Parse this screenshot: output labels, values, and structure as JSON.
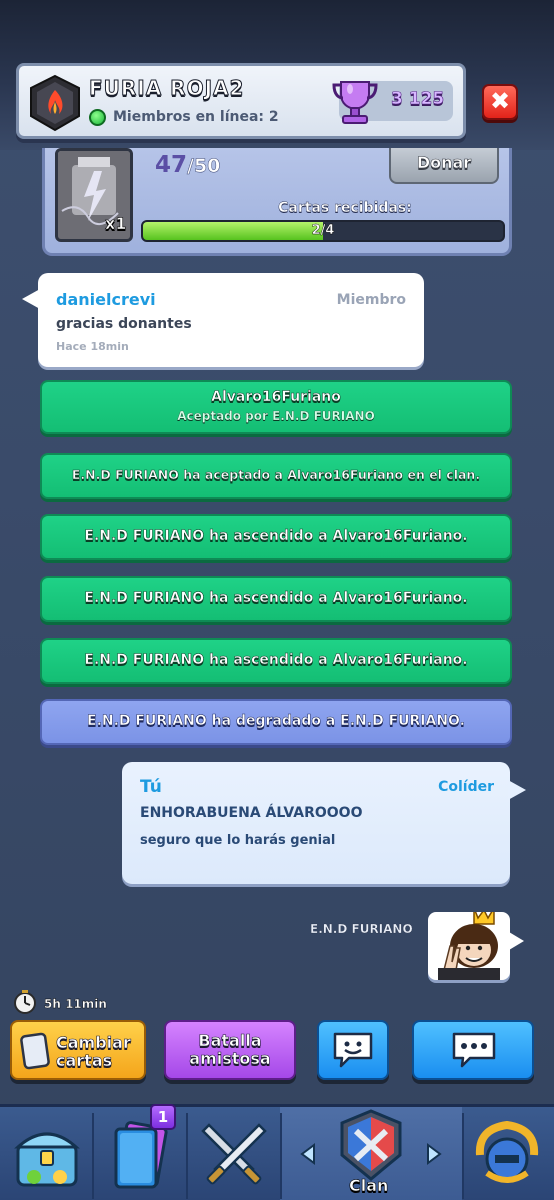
{
  "header": {
    "clan_name": "FURIA ROJA2",
    "online_label": "Miembros en línea: 2",
    "trophies": "3 125"
  },
  "donation": {
    "card_count": "x1",
    "requested_current": "47",
    "requested_total": "/50",
    "donate_label": "Donar",
    "cards_received_label": "Cartas recibidas:",
    "progress_text": "2/4",
    "progress_fraction": 0.5
  },
  "messages": [
    {
      "name": "danielcrevi",
      "role": "Miembro",
      "text": "gracias donantes",
      "time": "Hace 18min"
    }
  ],
  "events": [
    {
      "line1": "Alvaro16Furiano",
      "line2": "Aceptado por E.N.D FURIANO",
      "color": "green"
    },
    {
      "line1": "E.N.D FURIANO ha aceptado a Alvaro16Furiano en el clan.",
      "color": "green"
    },
    {
      "line1": "E.N.D FURIANO ha ascendido a Alvaro16Furiano.",
      "color": "green"
    },
    {
      "line1": "E.N.D FURIANO ha ascendido a Alvaro16Furiano.",
      "color": "green"
    },
    {
      "line1": "E.N.D FURIANO ha ascendido a Alvaro16Furiano.",
      "color": "green"
    },
    {
      "line1": "E.N.D FURIANO ha degradado a E.N.D FURIANO.",
      "color": "blue"
    }
  ],
  "own_message": {
    "name": "Tú",
    "role": "Colíder",
    "line1": "ENHORABUENA ÁLVAROOOO",
    "line2": "seguro que lo harás genial"
  },
  "emote": {
    "sender": "E.N.D FURIANO",
    "icon": "king-peace-emote-icon"
  },
  "actions": {
    "timer": "5h 11min",
    "trade_label_1": "Cambiar",
    "trade_label_2": "cartas",
    "battle_label_1": "Batalla",
    "battle_label_2": "amistosa"
  },
  "nav": {
    "cards_badge": "1",
    "active_label": "Clan"
  },
  "colors": {
    "event_green": "#14be74",
    "event_blue": "#7b93e6",
    "name_blue": "#1e9be0",
    "close_red": "#e2231a"
  }
}
